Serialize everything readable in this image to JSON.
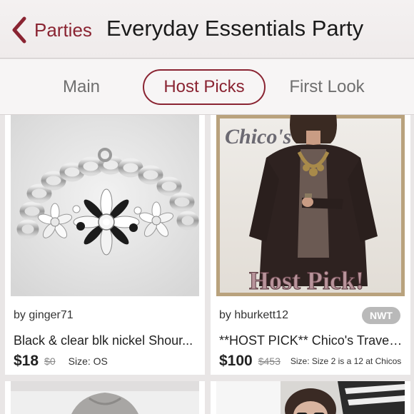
{
  "header": {
    "back_label": "Parties",
    "title": "Everyday Essentials Party",
    "accent_color": "#8a2432"
  },
  "tabs": [
    {
      "label": "Main",
      "active": false
    },
    {
      "label": "Host Picks",
      "active": true
    },
    {
      "label": "First Look",
      "active": false
    }
  ],
  "listings": [
    {
      "by_prefix": "by",
      "user": "ginger71",
      "badge": "",
      "title": "Black & clear blk nickel Shour...",
      "price": "$18",
      "original_price": "$0",
      "size": "Size: OS"
    },
    {
      "by_prefix": "by",
      "user": "hburkett12",
      "badge": "NWT",
      "title": "**HOST PICK** Chico's Travele...",
      "price": "$100",
      "original_price": "$453",
      "size": "Size: Size 2 is a 12 at Chicos",
      "image_text_brand": "Chico's",
      "image_text_label": "Host Pick!"
    }
  ]
}
